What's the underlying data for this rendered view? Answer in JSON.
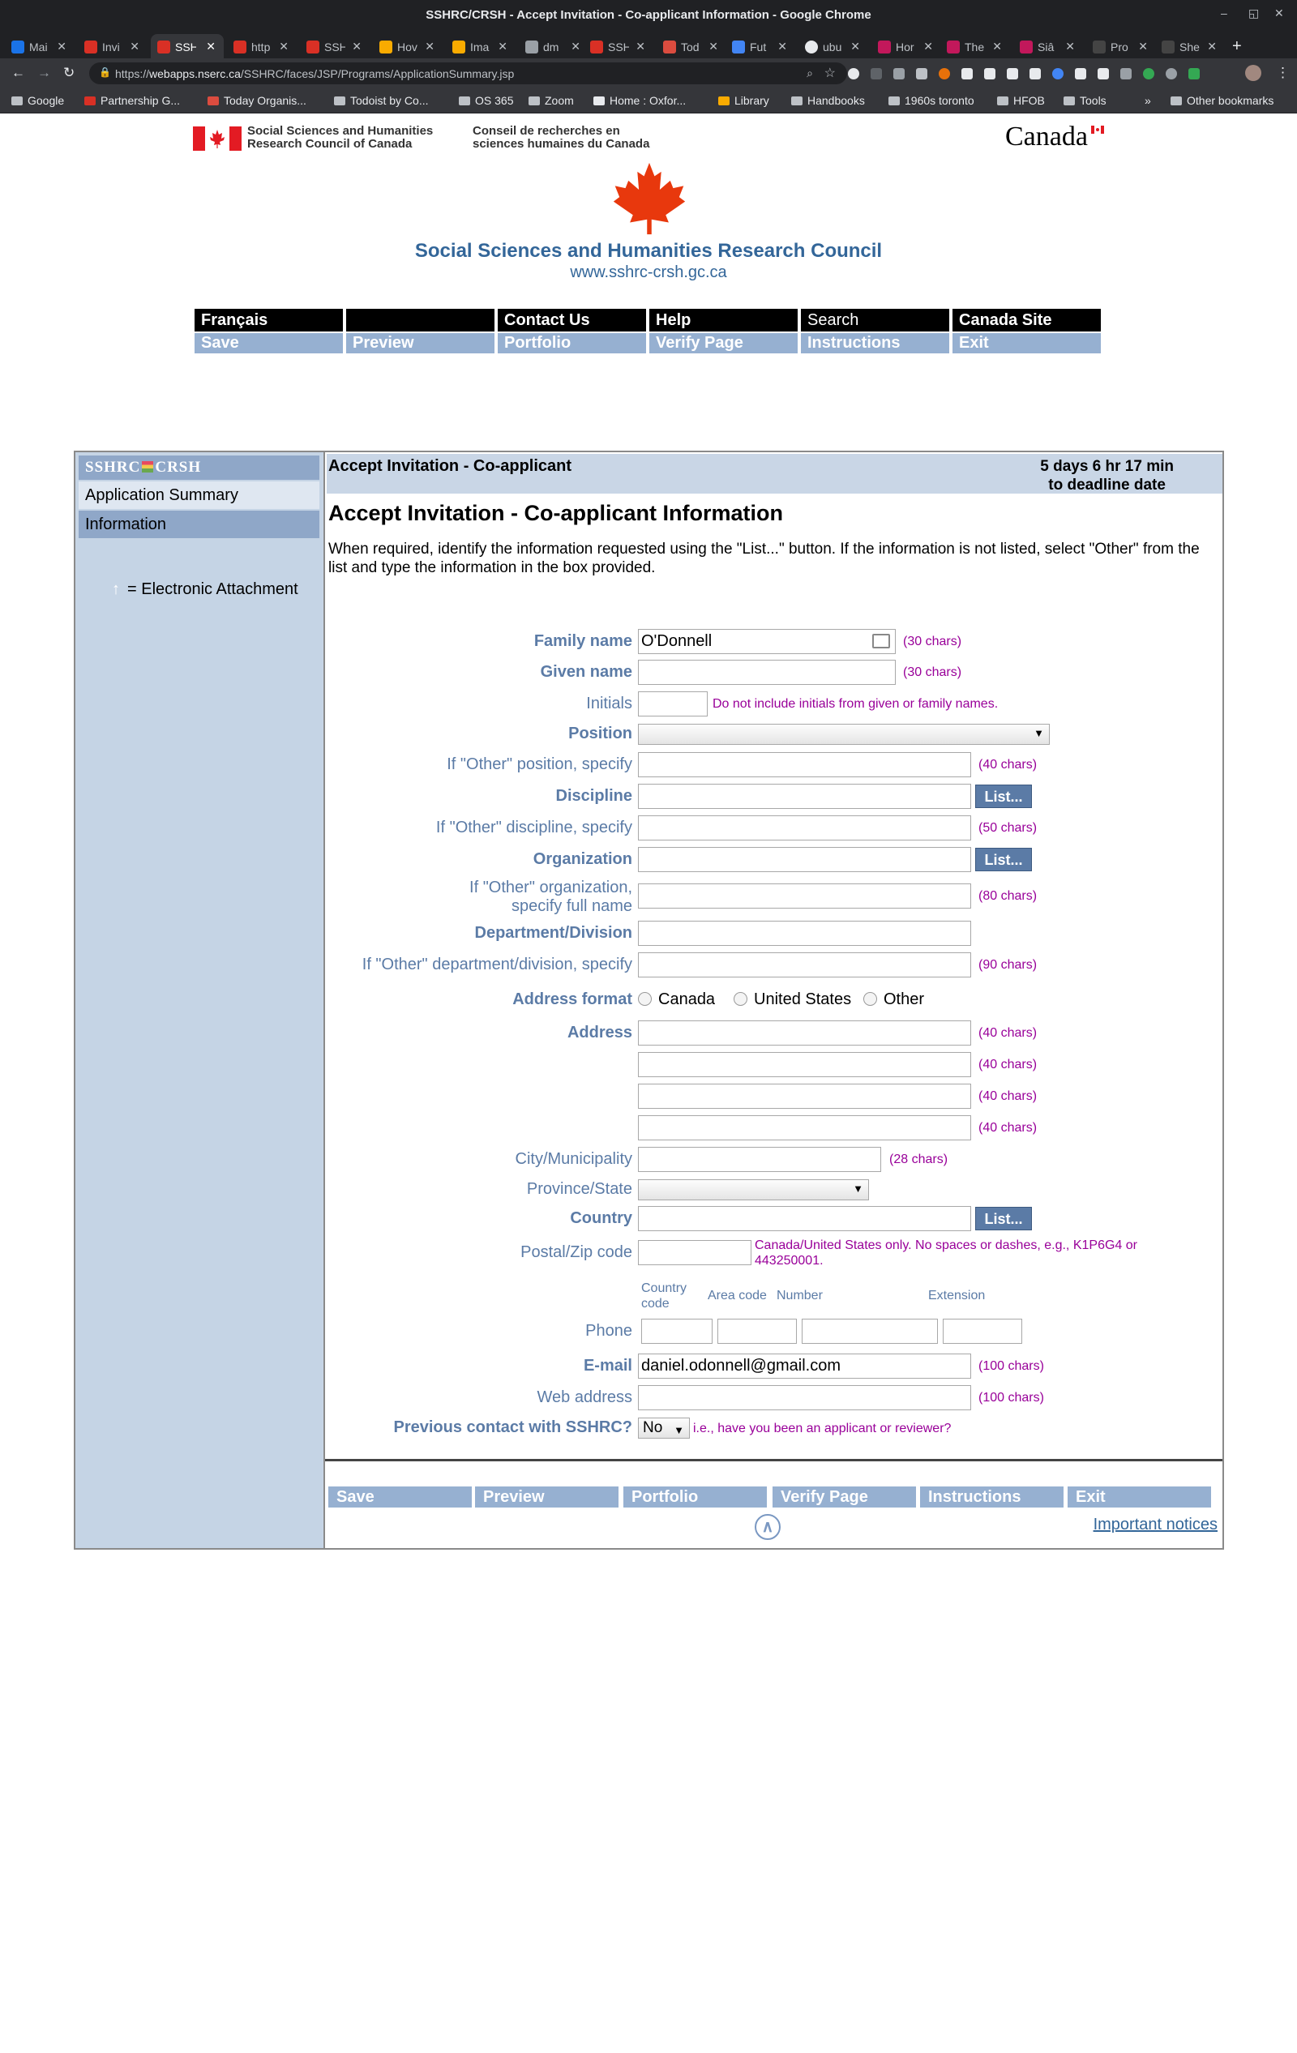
{
  "browser": {
    "window_title": "SSHRC/CRSH - Accept Invitation - Co-applicant Information - Google Chrome",
    "tabs": [
      {
        "label": "Mai",
        "color": "#1a73e8"
      },
      {
        "label": "Invi",
        "color": "#d93025"
      },
      {
        "label": "SSH",
        "color": "#d93025",
        "active": true
      },
      {
        "label": "http",
        "color": "#d93025"
      },
      {
        "label": "SSH",
        "color": "#d93025"
      },
      {
        "label": "Hov",
        "color": "#f9ab00"
      },
      {
        "label": "Ima",
        "color": "#f9ab00"
      },
      {
        "label": "dm",
        "color": "#9aa0a6"
      },
      {
        "label": "SSH",
        "color": "#d93025"
      },
      {
        "label": "Tod",
        "color": "#db4c3f"
      },
      {
        "label": "Fut",
        "color": "#4285f4"
      },
      {
        "label": "ubu",
        "color": "#e8eaed"
      },
      {
        "label": "Hor",
        "color": "#c2185b"
      },
      {
        "label": "The",
        "color": "#c2185b"
      },
      {
        "label": "Siâ",
        "color": "#c2185b"
      },
      {
        "label": "Pro",
        "color": "#444"
      },
      {
        "label": "She",
        "color": "#444"
      }
    ],
    "new_tab": "+",
    "url_host": "webapps.nserc.ca",
    "url_path": "/SSHRC/faces/JSP/Programs/ApplicationSummary.jsp",
    "url_scheme": "https://",
    "bookmarks": [
      "Google",
      "Partnership G...",
      "Today Organis...",
      "Todoist by Co...",
      "OS 365",
      "Zoom",
      "Home : Oxfor...",
      "Library",
      "Handbooks",
      "1960s toronto",
      "HFOB",
      "Tools",
      "»",
      "Other bookmarks"
    ]
  },
  "header": {
    "org_en_line1": "Social Sciences and Humanities",
    "org_en_line2": "Research Council of Canada",
    "org_fr_line1": "Conseil de recherches en",
    "org_fr_line2": "sciences humaines du Canada",
    "wordmark": "Canada",
    "council_name": "Social Sciences and Humanities Research Council",
    "council_url": "www.sshrc-crsh.gc.ca"
  },
  "topnav": {
    "row1": [
      "Français",
      "",
      "Contact Us",
      "Help",
      "Search",
      "Canada Site"
    ],
    "row2": [
      "Save",
      "Preview",
      "Portfolio",
      "Verify Page",
      "Instructions",
      "Exit"
    ]
  },
  "sidebar": {
    "logo_left": "SSHRC",
    "logo_right": "CRSH",
    "items": [
      "Application Summary",
      "Information"
    ],
    "legend_icon": "↑",
    "legend_text": "= Electronic Attachment"
  },
  "content": {
    "header_title": "Accept Invitation - Co-applicant",
    "deadline_line1": "5 days 6 hr 17 min",
    "deadline_line2": "to deadline date",
    "page_title": "Accept Invitation - Co-applicant Information",
    "instructions": "When required, identify the information requested using the \"List...\" button. If the information is not listed, select \"Other\" from the list and type the information in the box provided."
  },
  "form": {
    "family_name": {
      "label": "Family name",
      "value": "O'Donnell",
      "hint": "(30 chars)"
    },
    "given_name": {
      "label": "Given name",
      "value": "",
      "hint": "(30 chars)"
    },
    "initials": {
      "label": "Initials",
      "value": "",
      "hint": "Do not include initials from given or family names."
    },
    "position": {
      "label": "Position",
      "value": ""
    },
    "other_position": {
      "label": "If \"Other\" position, specify",
      "value": "",
      "hint": "(40 chars)"
    },
    "discipline": {
      "label": "Discipline",
      "value": "",
      "button": "List..."
    },
    "other_discipline": {
      "label": "If \"Other\" discipline, specify",
      "value": "",
      "hint": "(50 chars)"
    },
    "organization": {
      "label": "Organization",
      "value": "",
      "button": "List..."
    },
    "other_org_line1": "If \"Other\" organization,",
    "other_org_line2": "specify full name",
    "other_org_hint": "(80 chars)",
    "department": {
      "label": "Department/Division",
      "value": ""
    },
    "other_department": {
      "label": "If \"Other\" department/division, specify",
      "value": "",
      "hint": "(90 chars)"
    },
    "address_format": {
      "label": "Address format",
      "options": [
        "Canada",
        "United States",
        "Other"
      ]
    },
    "address": {
      "label": "Address",
      "hint": "(40 chars)",
      "lines": [
        "",
        "",
        "",
        ""
      ]
    },
    "city": {
      "label": "City/Municipality",
      "value": "",
      "hint": "(28 chars)"
    },
    "province": {
      "label": "Province/State",
      "value": ""
    },
    "country": {
      "label": "Country",
      "value": "",
      "button": "List..."
    },
    "postal": {
      "label": "Postal/Zip code",
      "value": "",
      "hint": "Canada/United States only. No spaces or dashes, e.g., K1P6G4 or 443250001."
    },
    "phone_headers": {
      "country_line1": "Country",
      "country_line2": "code",
      "area": "Area code",
      "number": "Number",
      "extension": "Extension"
    },
    "phone": {
      "label": "Phone"
    },
    "email": {
      "label": "E-mail",
      "value": "daniel.odonnell@gmail.com",
      "hint": "(100 chars)"
    },
    "web": {
      "label": "Web address",
      "value": "",
      "hint": "(100 chars)"
    },
    "previous_contact": {
      "label": "Previous contact with SSHRC?",
      "value": "No",
      "hint": "i.e., have you been an applicant or reviewer?"
    }
  },
  "footer": {
    "nav": [
      "Save",
      "Preview",
      "Portfolio",
      "Verify Page",
      "Instructions",
      "Exit"
    ],
    "top_icon": "∧",
    "notices": "Important notices"
  }
}
